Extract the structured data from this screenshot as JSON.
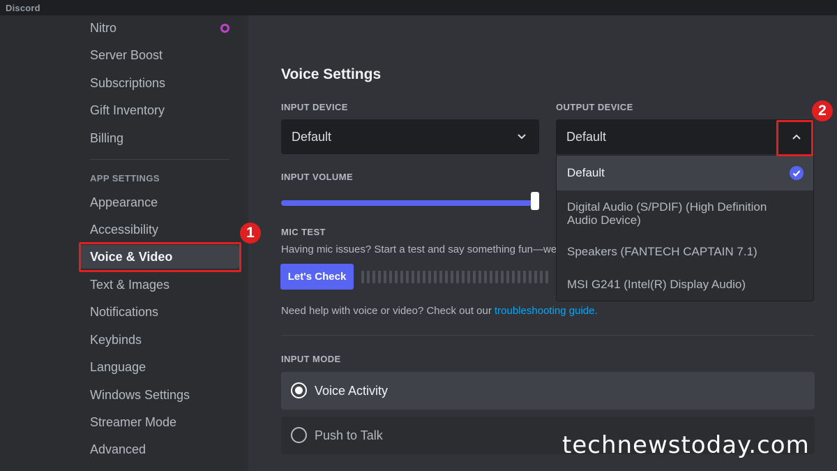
{
  "titlebar": {
    "app_title": "Discord"
  },
  "sidebar": {
    "items_top": [
      {
        "label": "Nitro"
      },
      {
        "label": "Server Boost"
      },
      {
        "label": "Subscriptions"
      },
      {
        "label": "Gift Inventory"
      },
      {
        "label": "Billing"
      }
    ],
    "app_settings_header": "APP SETTINGS",
    "items_app": [
      {
        "label": "Appearance"
      },
      {
        "label": "Accessibility"
      },
      {
        "label": "Voice & Video",
        "selected": true
      },
      {
        "label": "Text & Images"
      },
      {
        "label": "Notifications"
      },
      {
        "label": "Keybinds"
      },
      {
        "label": "Language"
      },
      {
        "label": "Windows Settings"
      },
      {
        "label": "Streamer Mode"
      },
      {
        "label": "Advanced"
      }
    ]
  },
  "annotations": {
    "badge_1": "1",
    "badge_2": "2",
    "color": "#e02020"
  },
  "voice": {
    "heading": "Voice Settings",
    "input_device_label": "INPUT DEVICE",
    "input_device_value": "Default",
    "output_device_label": "OUTPUT DEVICE",
    "output_device_value": "Default",
    "input_volume_label": "INPUT VOLUME",
    "input_volume_level": 1.0,
    "mic_test_label": "MIC TEST",
    "mic_test_desc": "Having mic issues? Start a test and say something fun—we",
    "check_button": "Let's Check",
    "help_text": "Need help with voice or video? Check out our ",
    "help_link": "troubleshooting guide.",
    "input_mode_label": "INPUT MODE",
    "modes": [
      {
        "label": "Voice Activity",
        "checked": true
      },
      {
        "label": "Push to Talk",
        "checked": false
      }
    ]
  },
  "output_dropdown": {
    "options": [
      {
        "label": "Default",
        "selected": true
      },
      {
        "label": "Digital Audio (S/PDIF) (High Definition Audio Device)"
      },
      {
        "label": "Speakers (FANTECH CAPTAIN 7.1)"
      },
      {
        "label": "MSI G241 (Intel(R) Display Audio)"
      }
    ]
  },
  "watermark": "technewstoday.com",
  "colors": {
    "accent": "#5865f2",
    "link": "#00a8fc",
    "background": "#313338",
    "sidebar": "#2b2d31"
  }
}
